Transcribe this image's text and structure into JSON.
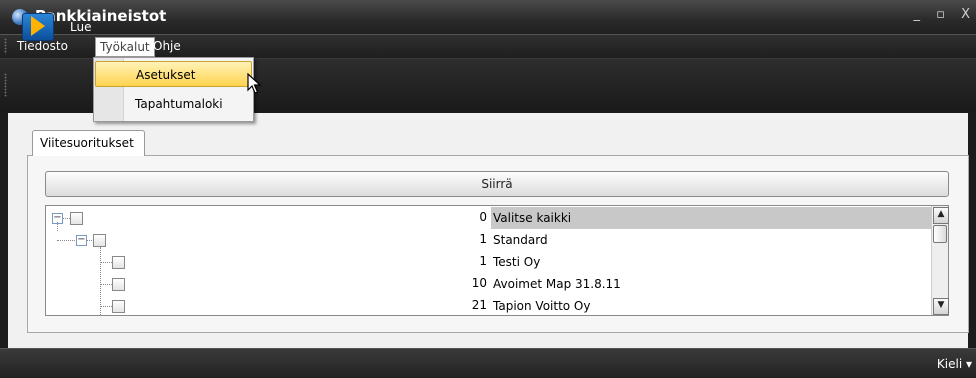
{
  "window": {
    "title": "Pankkiaineistot",
    "controls": "_ ▫ X",
    "icon": "globe-icon"
  },
  "menubar": {
    "items": [
      "Tiedosto",
      "Työkalut",
      "Ohje"
    ],
    "open_item": "Työkalut"
  },
  "toolbar": {
    "import_label": "Lue",
    "import_icon": "import-arrow-icon"
  },
  "dropdown": {
    "items": [
      "Asetukset",
      "Tapahtumaloki"
    ],
    "highlighted": "Asetukset"
  },
  "tabs": [
    "Viitesuoritukset"
  ],
  "actions": {
    "move_label": "Siirrä"
  },
  "tree": {
    "rows": [
      {
        "count": "0",
        "label": "Valitse kaikki",
        "selected": true
      },
      {
        "count": "1",
        "label": "Standard"
      },
      {
        "count": "1",
        "label": "Testi Oy"
      },
      {
        "count": "10",
        "label": "Avoimet Map 31.8.11"
      },
      {
        "count": "21",
        "label": "Tapion Voitto Oy"
      }
    ]
  },
  "statusbar": {
    "language_label": "Kieli ▾"
  },
  "colors": {
    "chrome_dark": "#1c1c1c",
    "highlight_yellow": "#ffd34f",
    "selection_gray": "#c8c8c8"
  }
}
